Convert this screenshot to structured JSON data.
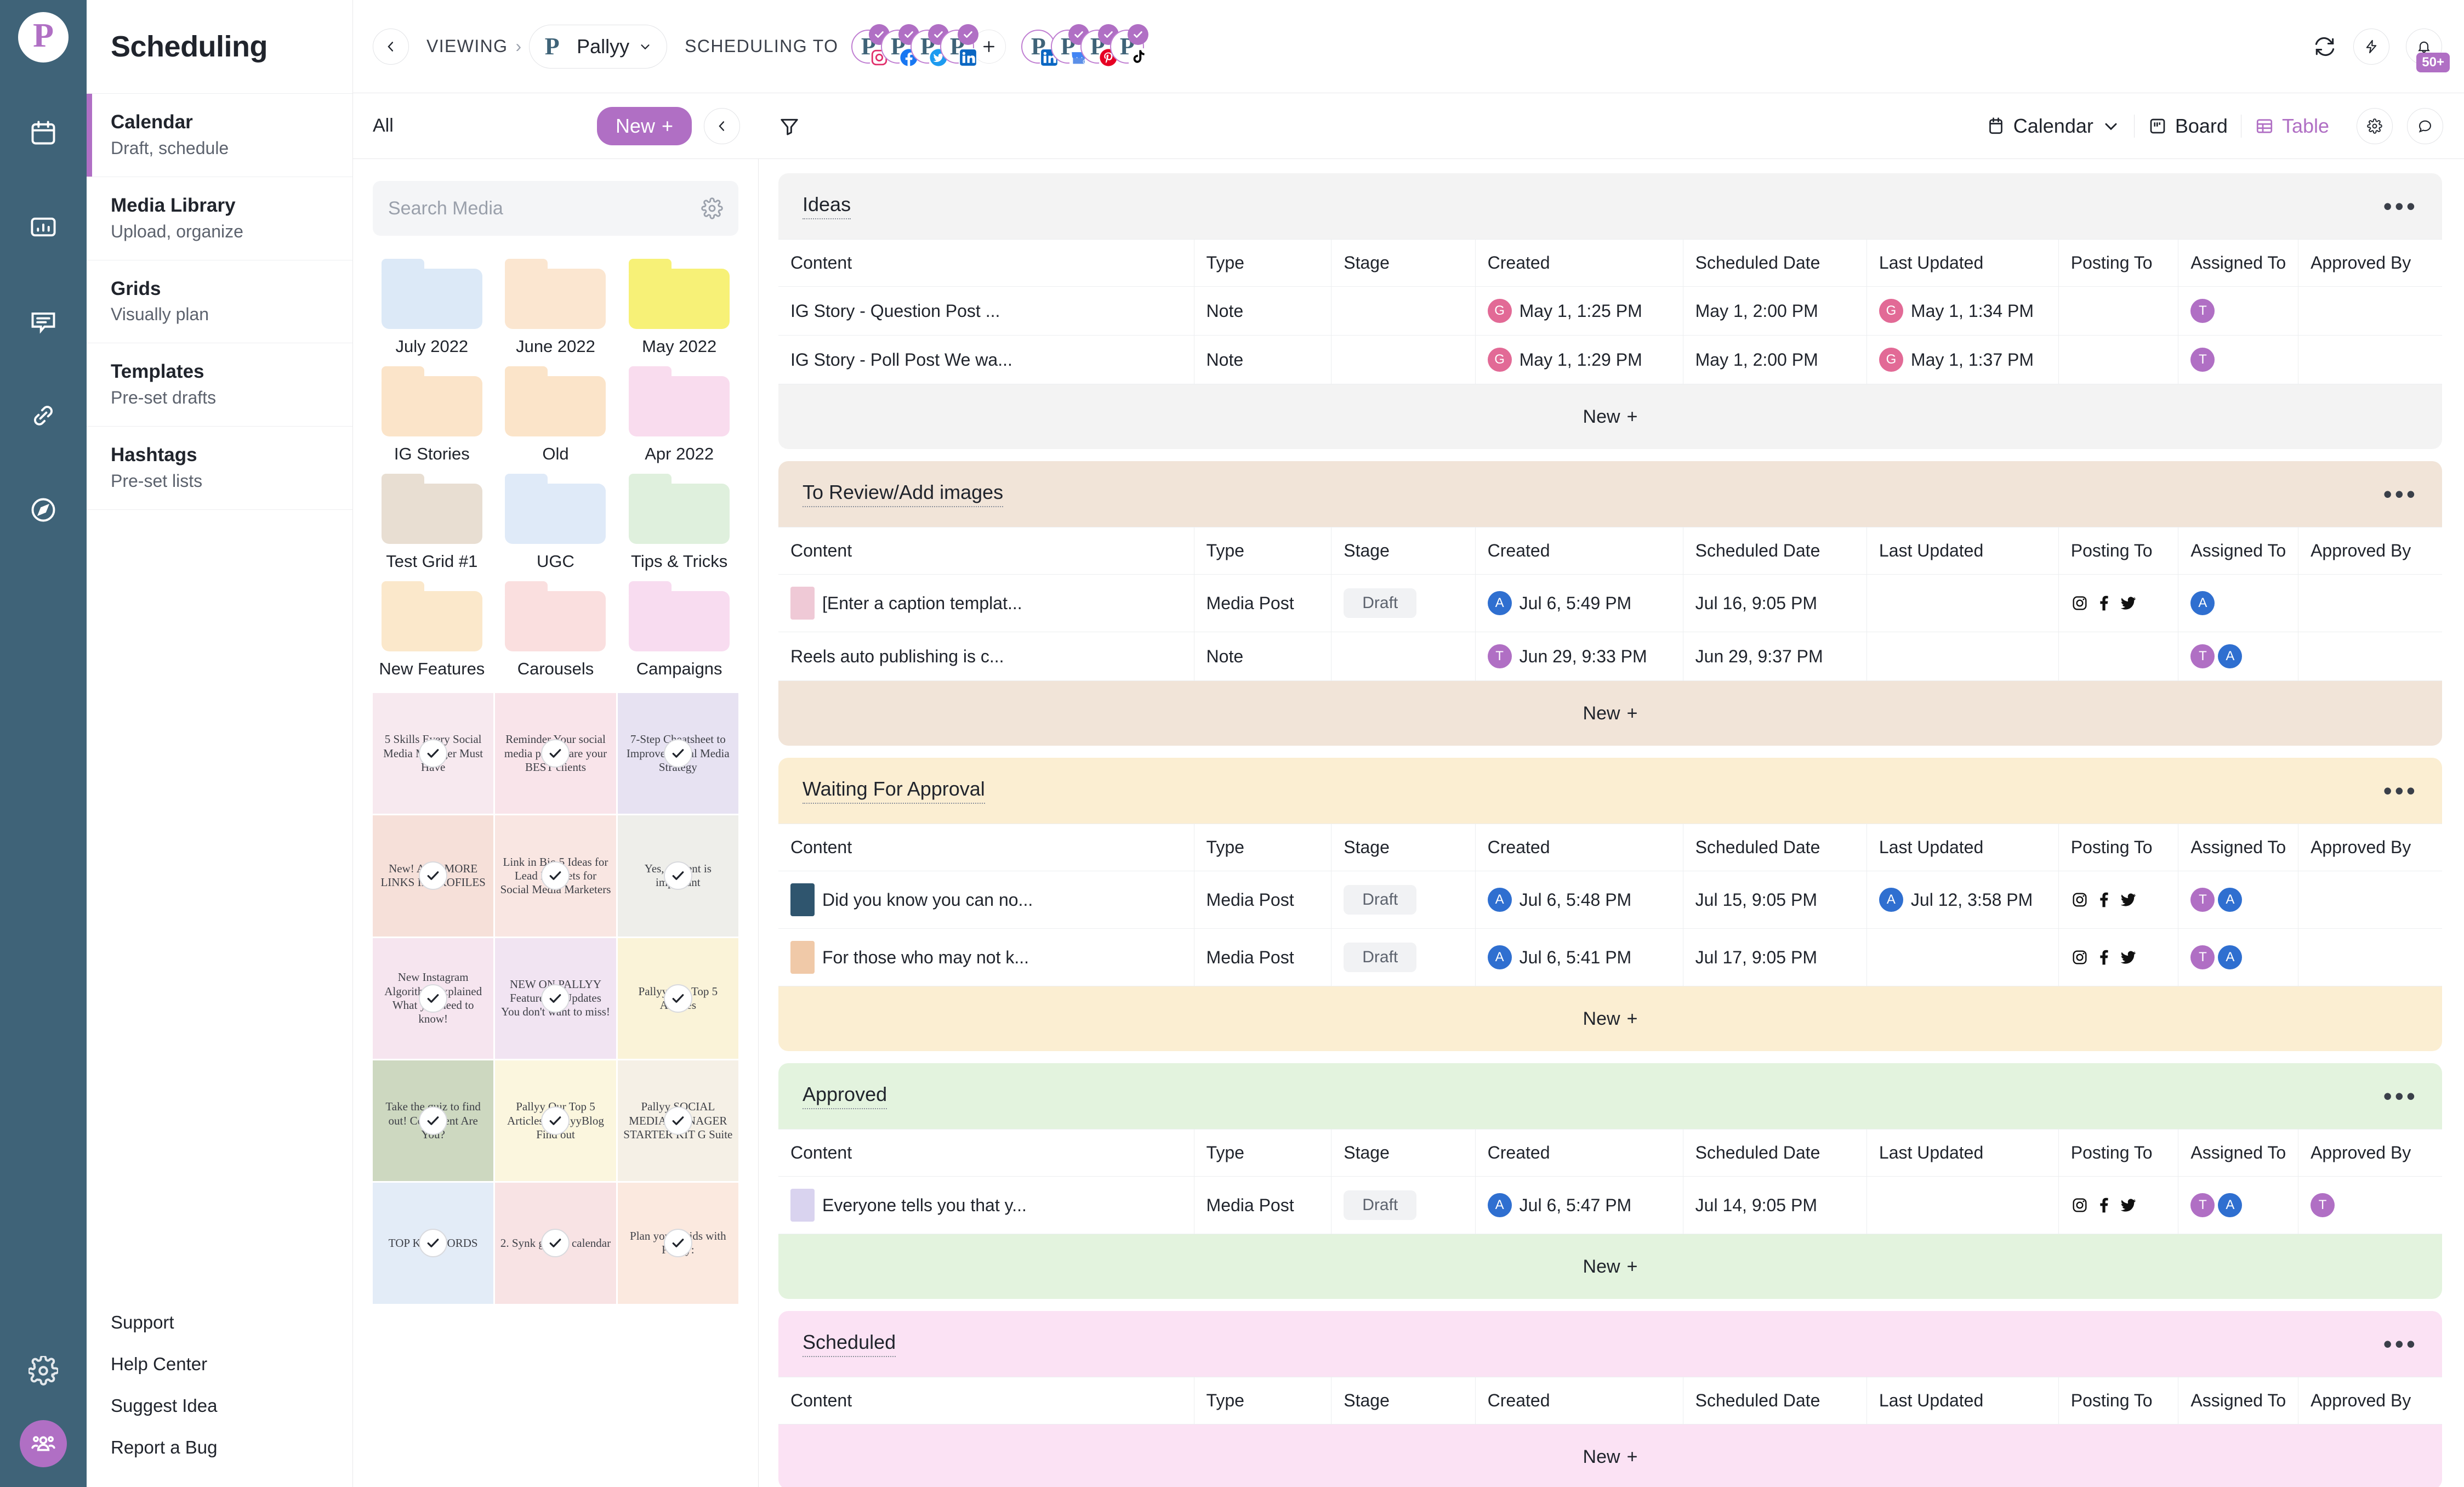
{
  "brand": {
    "logo_letter": "P",
    "accent": "#b06fc4",
    "rail_bg": "#3f6378"
  },
  "rail": {
    "icons": [
      {
        "name": "calendar-icon"
      },
      {
        "name": "analytics-icon"
      },
      {
        "name": "inbox-icon"
      },
      {
        "name": "link-icon"
      },
      {
        "name": "discover-icon"
      }
    ],
    "settings_icon": "gear-icon",
    "avatar_icon": "team-avatar"
  },
  "subnav": {
    "title": "Scheduling",
    "items": [
      {
        "label": "Calendar",
        "sub": "Draft, schedule",
        "active": true
      },
      {
        "label": "Media Library",
        "sub": "Upload, organize",
        "active": false
      },
      {
        "label": "Grids",
        "sub": "Visually plan",
        "active": false
      },
      {
        "label": "Templates",
        "sub": "Pre-set drafts",
        "active": false
      },
      {
        "label": "Hashtags",
        "sub": "Pre-set lists",
        "active": false
      }
    ],
    "links": [
      "Support",
      "Help Center",
      "Suggest Idea",
      "Report a Bug"
    ]
  },
  "topbar": {
    "back_icon": "chevron-left-icon",
    "viewing_label": "VIEWING",
    "separator": "›",
    "account": {
      "name": "Pallyy",
      "initial": "P",
      "chevron": "⌄"
    },
    "scheduling_to_label": "SCHEDULING TO",
    "accounts": [
      {
        "platform": "instagram",
        "verified": true
      },
      {
        "platform": "facebook",
        "verified": true
      },
      {
        "platform": "twitter",
        "verified": true
      },
      {
        "platform": "linkedin",
        "verified": true
      }
    ],
    "add_account_icon": "plus-icon",
    "accounts2": [
      {
        "platform": "linkedin",
        "verified": false
      },
      {
        "platform": "google-business",
        "verified": true
      },
      {
        "platform": "pinterest",
        "verified": true
      },
      {
        "platform": "tiktok",
        "verified": true
      }
    ],
    "sync_icon": "sync-icon",
    "bolt_icon": "bolt-icon",
    "bell_icon": "bell-icon",
    "notification_count": "50+"
  },
  "toolbar": {
    "all_label": "All",
    "new_label": "New",
    "new_plus": "+",
    "collapse_icon": "chevron-left-icon",
    "filter_icon": "filter-icon",
    "views": [
      {
        "label": "Calendar",
        "icon": "calendar-view-icon",
        "active": false,
        "has_chevron": true
      },
      {
        "label": "Board",
        "icon": "board-view-icon",
        "active": false,
        "has_chevron": false
      },
      {
        "label": "Table",
        "icon": "table-view-icon",
        "active": true,
        "has_chevron": false
      }
    ],
    "settings_icon": "gear-icon",
    "chat_icon": "chat-icon"
  },
  "media": {
    "search_placeholder": "Search Media",
    "search_value": "",
    "settings_icon": "gear-icon",
    "folders": [
      {
        "name": "July 2022",
        "color": "#dce9f7"
      },
      {
        "name": "June 2022",
        "color": "#fbe6d0"
      },
      {
        "name": "May 2022",
        "color": "#f7f177"
      },
      {
        "name": "IG Stories",
        "color": "#fbe4c9"
      },
      {
        "name": "Old",
        "color": "#fbe4c9"
      },
      {
        "name": "Apr 2022",
        "color": "#f9dcee"
      },
      {
        "name": "Test Grid #1",
        "color": "#e8ded2"
      },
      {
        "name": "UGC",
        "color": "#dfeaf8"
      },
      {
        "name": "Tips & Tricks",
        "color": "#dff0dd"
      },
      {
        "name": "New Features",
        "color": "#fbe8cb"
      },
      {
        "name": "Carousels",
        "color": "#fadfdf"
      },
      {
        "name": "Campaigns",
        "color": "#f8dcf0"
      }
    ],
    "thumbnails": [
      {
        "caption": "5 Skills Every Social Media Manager Must Have",
        "bg": "#f7e9ef",
        "selected": true
      },
      {
        "caption": "Reminder Your social media profile are your BEST clients",
        "bg": "#f9e4ea",
        "selected": true
      },
      {
        "caption": "7-Step Cheatsheet to Improve Social Media Strategy",
        "bg": "#e7e2f2",
        "selected": true
      },
      {
        "caption": "New! ADD MORE LINKS IN PROFILES",
        "bg": "#f6e0d9",
        "selected": true
      },
      {
        "caption": "Link in Bio 5 Ideas for Lead Magnets for Social Media Marketers",
        "bg": "#f9e6e2",
        "selected": true
      },
      {
        "caption": "Yes, content is important",
        "bg": "#eeeeea",
        "selected": true
      },
      {
        "caption": "New Instagram Algorithm Explained What you need to know!",
        "bg": "#f6e5ef",
        "selected": true
      },
      {
        "caption": "NEW ON PALLYY Features & Updates You don't want to miss!",
        "bg": "#f1e4f2",
        "selected": true
      },
      {
        "caption": "Pallyy Our Top 5 Articles",
        "bg": "#faf3d8",
        "selected": true
      },
      {
        "caption": "Take the quiz to find out! Consistent Are You?",
        "bg": "#cdd8c0",
        "selected": true
      },
      {
        "caption": "Pallyy Our Top 5 Articles #PallyyBlog Find out",
        "bg": "#fbf6de",
        "selected": true
      },
      {
        "caption": "Pallyy SOCIAL MEDIA MANAGER STARTER KIT G Suite",
        "bg": "#f5f0e6",
        "selected": true
      },
      {
        "caption": "TOP KEYWORDS",
        "bg": "#e3ecf7",
        "selected": true
      },
      {
        "caption": "2. Synk grid to calendar",
        "bg": "#f8e3e4",
        "selected": true
      },
      {
        "caption": "Plan your Grids with Pallyy:",
        "bg": "#fbe9df",
        "selected": true
      }
    ]
  },
  "tables": {
    "columns": [
      "Content",
      "Type",
      "Stage",
      "Created",
      "Scheduled Date",
      "Last Updated",
      "Posting To",
      "Assigned To",
      "Approved By"
    ],
    "new_row_label": "New",
    "new_row_plus": "+",
    "menu_icon": "more-options-icon",
    "groups": [
      {
        "title": "Ideas",
        "bg": "#f3f3f3",
        "rows": [
          {
            "content": "IG Story - Question Post ...",
            "has_thumb": false,
            "thumb_color": "",
            "type": "Note",
            "stage": "",
            "created": {
              "avatar": "G",
              "avatar_class": "g",
              "text": "May 1, 1:25 PM"
            },
            "scheduled": "May 1, 2:00 PM",
            "updated": {
              "avatar": "G",
              "avatar_class": "g",
              "text": "May 1, 1:34 PM"
            },
            "posting_to": [],
            "assigned_to": [
              {
                "label": "T",
                "cls": "t"
              }
            ],
            "approved_by": []
          },
          {
            "content": "IG Story - Poll Post We wa...",
            "has_thumb": false,
            "thumb_color": "",
            "type": "Note",
            "stage": "",
            "created": {
              "avatar": "G",
              "avatar_class": "g",
              "text": "May 1, 1:29 PM"
            },
            "scheduled": "May 1, 2:00 PM",
            "updated": {
              "avatar": "G",
              "avatar_class": "g",
              "text": "May 1, 1:37 PM"
            },
            "posting_to": [],
            "assigned_to": [
              {
                "label": "T",
                "cls": "t"
              }
            ],
            "approved_by": []
          }
        ]
      },
      {
        "title": "To Review/Add images",
        "bg": "#f1e4d8",
        "rows": [
          {
            "content": "[Enter a caption templat...",
            "has_thumb": true,
            "thumb_color": "#efc9d6",
            "type": "Media Post",
            "stage": "Draft",
            "created": {
              "avatar": "A",
              "avatar_class": "a",
              "text": "Jul 6, 5:49 PM"
            },
            "scheduled": "Jul 16, 9:05 PM",
            "updated": {
              "avatar": "",
              "avatar_class": "",
              "text": ""
            },
            "posting_to": [
              "instagram",
              "facebook",
              "twitter"
            ],
            "assigned_to": [
              {
                "label": "A",
                "cls": "a"
              }
            ],
            "approved_by": []
          },
          {
            "content": "Reels auto publishing is c...",
            "has_thumb": false,
            "thumb_color": "",
            "type": "Note",
            "stage": "",
            "created": {
              "avatar": "T",
              "avatar_class": "t",
              "text": "Jun 29, 9:33 PM"
            },
            "scheduled": "Jun 29, 9:37 PM",
            "updated": {
              "avatar": "",
              "avatar_class": "",
              "text": ""
            },
            "posting_to": [],
            "assigned_to": [
              {
                "label": "T",
                "cls": "t"
              },
              {
                "label": "A",
                "cls": "a"
              }
            ],
            "approved_by": []
          }
        ]
      },
      {
        "title": "Waiting For Approval",
        "bg": "#fbeed2",
        "rows": [
          {
            "content": "Did you know you can no...",
            "has_thumb": true,
            "thumb_color": "#2f556e",
            "type": "Media Post",
            "stage": "Draft",
            "created": {
              "avatar": "A",
              "avatar_class": "a",
              "text": "Jul 6, 5:48 PM"
            },
            "scheduled": "Jul 15, 9:05 PM",
            "updated": {
              "avatar": "A",
              "avatar_class": "a",
              "text": "Jul 12, 3:58 PM"
            },
            "posting_to": [
              "instagram",
              "facebook",
              "twitter"
            ],
            "assigned_to": [
              {
                "label": "T",
                "cls": "t"
              },
              {
                "label": "A",
                "cls": "a"
              }
            ],
            "approved_by": []
          },
          {
            "content": "For those who may not k...",
            "has_thumb": true,
            "thumb_color": "#f0c9a8",
            "type": "Media Post",
            "stage": "Draft",
            "created": {
              "avatar": "A",
              "avatar_class": "a",
              "text": "Jul 6, 5:41 PM"
            },
            "scheduled": "Jul 17, 9:05 PM",
            "updated": {
              "avatar": "",
              "avatar_class": "",
              "text": ""
            },
            "posting_to": [
              "instagram",
              "facebook",
              "twitter"
            ],
            "assigned_to": [
              {
                "label": "T",
                "cls": "t"
              },
              {
                "label": "A",
                "cls": "a"
              }
            ],
            "approved_by": []
          }
        ]
      },
      {
        "title": "Approved",
        "bg": "#e3f3de",
        "rows": [
          {
            "content": "Everyone tells you that y...",
            "has_thumb": true,
            "thumb_color": "#d9d3ef",
            "type": "Media Post",
            "stage": "Draft",
            "created": {
              "avatar": "A",
              "avatar_class": "a",
              "text": "Jul 6, 5:47 PM"
            },
            "scheduled": "Jul 14, 9:05 PM",
            "updated": {
              "avatar": "",
              "avatar_class": "",
              "text": ""
            },
            "posting_to": [
              "instagram",
              "facebook",
              "twitter"
            ],
            "assigned_to": [
              {
                "label": "T",
                "cls": "t"
              },
              {
                "label": "A",
                "cls": "a"
              }
            ],
            "approved_by": [
              {
                "label": "T",
                "cls": "t"
              }
            ]
          }
        ]
      },
      {
        "title": "Scheduled",
        "bg": "#fbe2f4",
        "rows": []
      }
    ]
  }
}
